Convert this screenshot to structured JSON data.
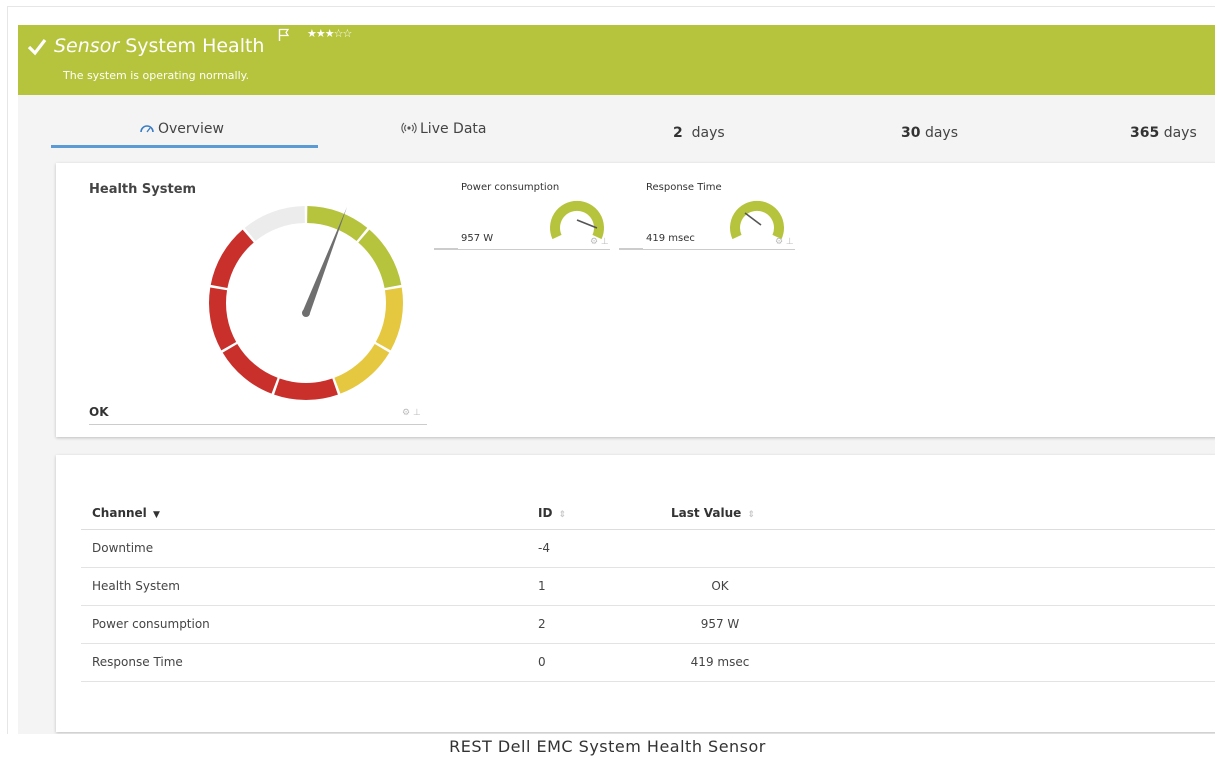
{
  "header": {
    "kind": "Sensor",
    "name": "System Health",
    "stars": "★★★☆☆",
    "status_message": "The system is operating normally.",
    "color": "#b5c43c"
  },
  "tabs": [
    {
      "label": "Overview",
      "icon": "gauge-icon",
      "active": true
    },
    {
      "label": "Live Data",
      "icon": "broadcast-icon"
    },
    {
      "number": "2",
      "unit": "days"
    },
    {
      "number": "30",
      "unit": "days"
    },
    {
      "number": "365",
      "unit": "days"
    }
  ],
  "gauges": {
    "health": {
      "title": "Health System",
      "value": "OK"
    },
    "power": {
      "title": "Power consumption",
      "value": "957 W"
    },
    "response": {
      "title": "Response Time",
      "value": "419 msec"
    }
  },
  "table": {
    "headers": {
      "channel": "Channel",
      "id": "ID",
      "last_value": "Last Value"
    },
    "rows": [
      {
        "channel": "Downtime",
        "id": "-4",
        "last_value": ""
      },
      {
        "channel": "Health System",
        "id": "1",
        "last_value": "OK"
      },
      {
        "channel": "Power consumption",
        "id": "2",
        "last_value": "957 W"
      },
      {
        "channel": "Response Time",
        "id": "0",
        "last_value": "419 msec"
      }
    ]
  },
  "caption": "REST Dell EMC System Health Sensor"
}
